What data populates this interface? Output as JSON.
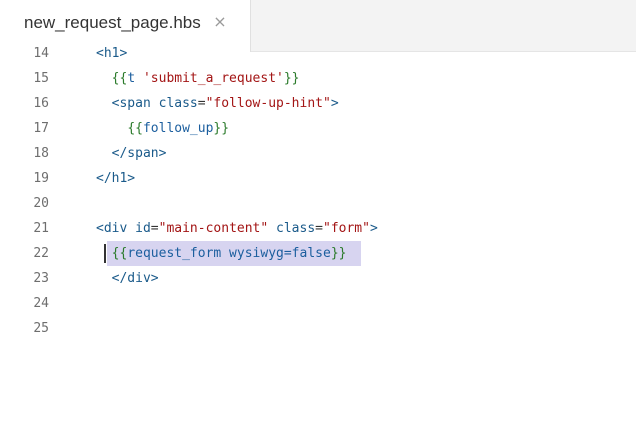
{
  "tab": {
    "filename": "new_request_page.hbs",
    "close_glyph": "×"
  },
  "lines": [
    {
      "n": "14",
      "indent": "",
      "segments": [
        {
          "cls": "tag",
          "t": "<h1>"
        }
      ]
    },
    {
      "n": "15",
      "indent": "  ",
      "segments": [
        {
          "cls": "hb",
          "t": "{{"
        },
        {
          "cls": "hbname",
          "t": "t "
        },
        {
          "cls": "str",
          "t": "'submit_a_request'"
        },
        {
          "cls": "hb",
          "t": "}}"
        }
      ]
    },
    {
      "n": "16",
      "indent": "  ",
      "segments": [
        {
          "cls": "tag",
          "t": "<span "
        },
        {
          "cls": "attr",
          "t": "class"
        },
        {
          "cls": "eq",
          "t": "="
        },
        {
          "cls": "str",
          "t": "\"follow-up-hint\""
        },
        {
          "cls": "tag",
          "t": ">"
        }
      ]
    },
    {
      "n": "17",
      "indent": "    ",
      "segments": [
        {
          "cls": "hb",
          "t": "{{"
        },
        {
          "cls": "hbname",
          "t": "follow_up"
        },
        {
          "cls": "hb",
          "t": "}}"
        }
      ]
    },
    {
      "n": "18",
      "indent": "  ",
      "segments": [
        {
          "cls": "tag",
          "t": "</span>"
        }
      ]
    },
    {
      "n": "19",
      "indent": "",
      "segments": [
        {
          "cls": "tag",
          "t": "</h1>"
        }
      ]
    },
    {
      "n": "20",
      "indent": "",
      "segments": []
    },
    {
      "n": "21",
      "indent": "",
      "segments": [
        {
          "cls": "tag",
          "t": "<div "
        },
        {
          "cls": "attr",
          "t": "id"
        },
        {
          "cls": "eq",
          "t": "="
        },
        {
          "cls": "str",
          "t": "\"main-content\""
        },
        {
          "cls": "eq",
          "t": " "
        },
        {
          "cls": "attr",
          "t": "class"
        },
        {
          "cls": "eq",
          "t": "="
        },
        {
          "cls": "str",
          "t": "\"form\""
        },
        {
          "cls": "tag",
          "t": ">"
        }
      ]
    },
    {
      "n": "22",
      "indent": "  ",
      "selected": true,
      "segments": [
        {
          "cls": "hb",
          "t": "{{"
        },
        {
          "cls": "hbname",
          "t": "request_form wysiwyg=false"
        },
        {
          "cls": "hb",
          "t": "}}"
        }
      ]
    },
    {
      "n": "23",
      "indent": "  ",
      "segments": [
        {
          "cls": "tag",
          "t": "</div>"
        }
      ]
    },
    {
      "n": "24",
      "indent": "",
      "segments": []
    },
    {
      "n": "25",
      "indent": "",
      "segments": []
    }
  ],
  "colors": {
    "tag": "#1a5a8a",
    "string": "#a31515",
    "handlebars": "#2a7a2a",
    "selection": "#d7d4f0"
  }
}
